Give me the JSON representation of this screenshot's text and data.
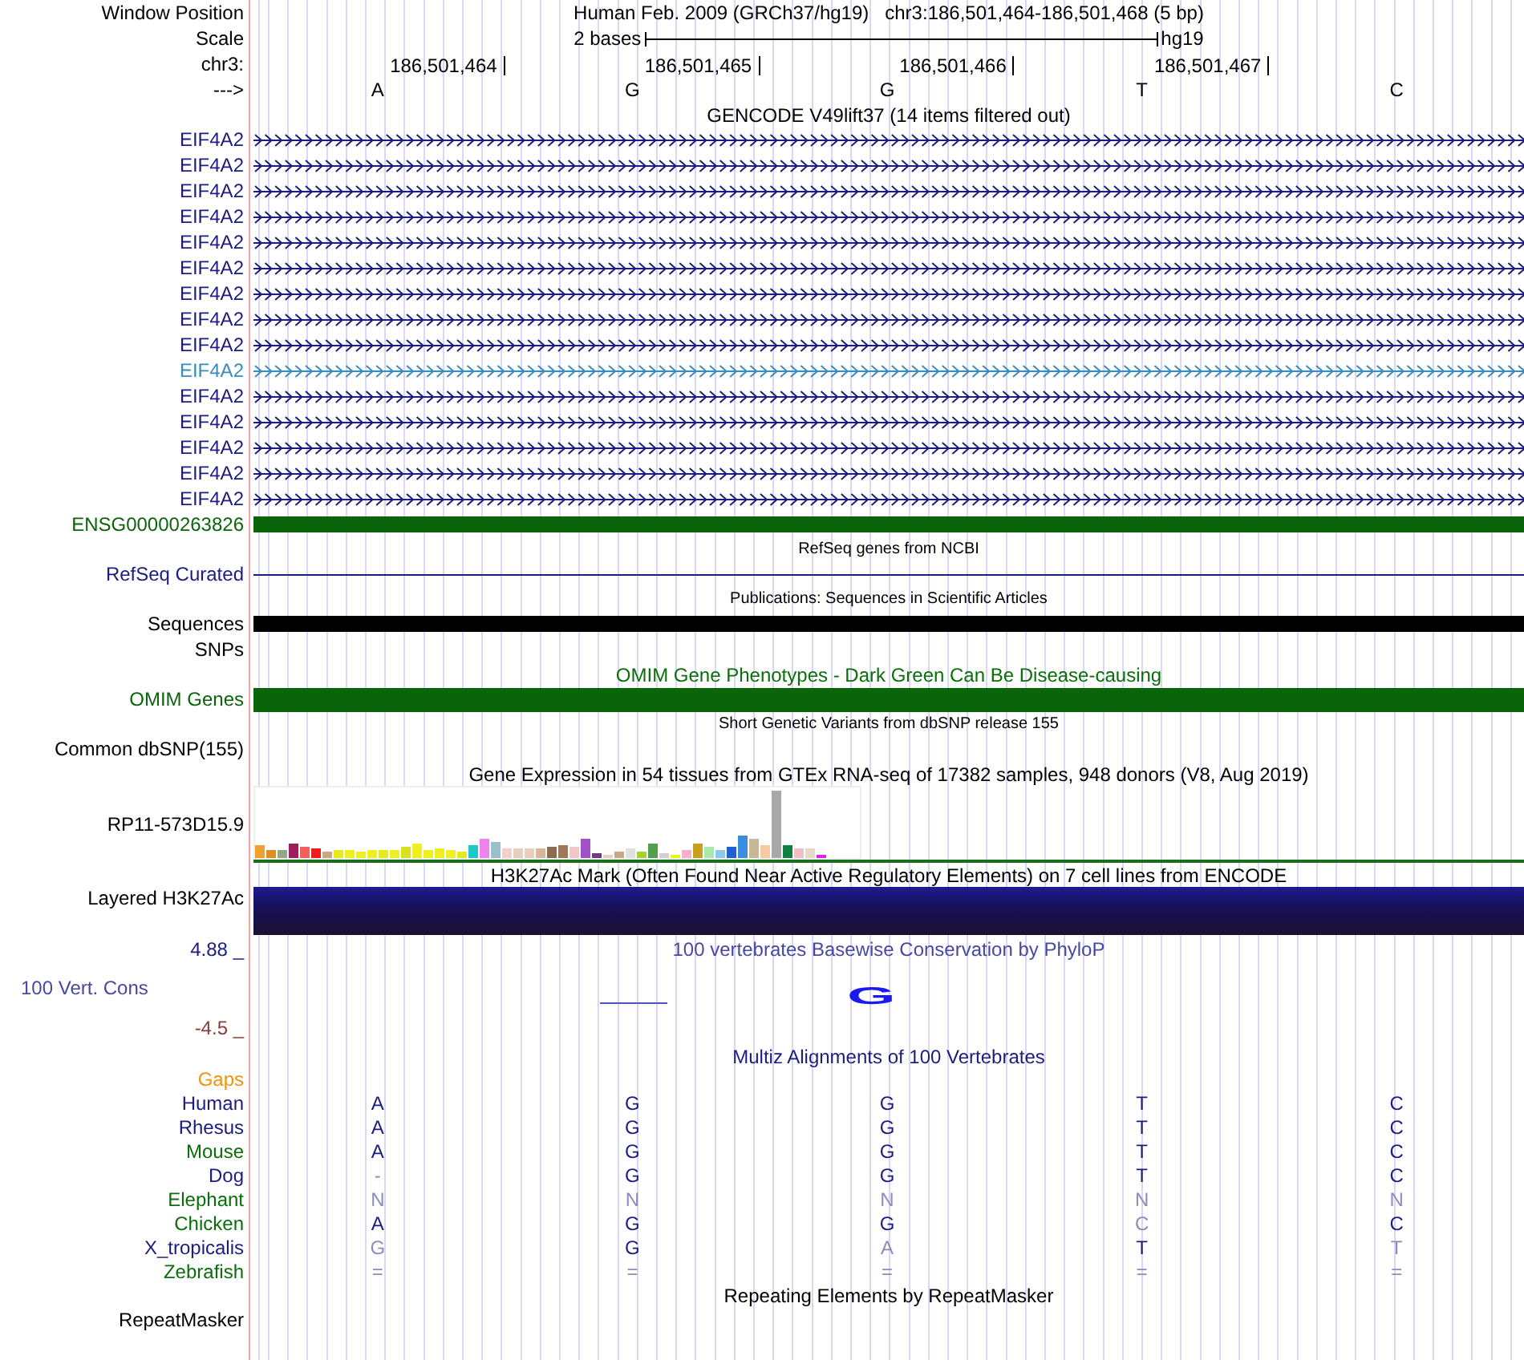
{
  "header": {
    "position": {
      "label": "Window Position",
      "text": "Human Feb. 2009 (GRCh37/hg19)   chr3:186,501,464-186,501,468 (5 bp)"
    },
    "scale": {
      "label": "Scale",
      "span": "2 bases",
      "assembly": "hg19"
    },
    "coords": {
      "label": "chr3:",
      "ticks": [
        "186,501,464",
        "186,501,465",
        "186,501,466",
        "186,501,467"
      ]
    },
    "strand": {
      "label": "--->",
      "bases": [
        "A",
        "G",
        "G",
        "T",
        "C"
      ]
    }
  },
  "tracks": [
    {
      "kind": "title",
      "text": "GENCODE V49lift37 (14 items filtered out)",
      "color": "#000000"
    },
    {
      "kind": "genes",
      "rows": [
        {
          "label": "EIF4A2",
          "color": "#1c1c80"
        },
        {
          "label": "EIF4A2",
          "color": "#1c1c80"
        },
        {
          "label": "EIF4A2",
          "color": "#1c1c80"
        },
        {
          "label": "EIF4A2",
          "color": "#1c1c80"
        },
        {
          "label": "EIF4A2",
          "color": "#1c1c80"
        },
        {
          "label": "EIF4A2",
          "color": "#1c1c80"
        },
        {
          "label": "EIF4A2",
          "color": "#1c1c80"
        },
        {
          "label": "EIF4A2",
          "color": "#1c1c80"
        },
        {
          "label": "EIF4A2",
          "color": "#1c1c80"
        },
        {
          "label": "EIF4A2",
          "color": "#3a8cc0"
        },
        {
          "label": "EIF4A2",
          "color": "#1c1c80"
        },
        {
          "label": "EIF4A2",
          "color": "#1c1c80"
        },
        {
          "label": "EIF4A2",
          "color": "#1c1c80"
        },
        {
          "label": "EIF4A2",
          "color": "#1c1c80"
        },
        {
          "label": "EIF4A2",
          "color": "#1c1c80"
        }
      ]
    },
    {
      "kind": "block",
      "label": "ENSG00000263826",
      "color": "#0a640a"
    },
    {
      "kind": "note",
      "text": "RefSeq genes from NCBI"
    },
    {
      "kind": "line",
      "label": "RefSeq Curated",
      "color": "#1c1c80"
    },
    {
      "kind": "note",
      "text": "Publications: Sequences in Scientific Articles"
    },
    {
      "kind": "block",
      "label": "Sequences",
      "color": "#000000"
    },
    {
      "kind": "empty",
      "label": "SNPs"
    },
    {
      "kind": "title",
      "text": "OMIM Gene Phenotypes - Dark Green Can Be Disease-causing",
      "color": "#0a6e0a"
    },
    {
      "kind": "block",
      "label": "OMIM Genes",
      "color": "#0a640a"
    },
    {
      "kind": "note",
      "text": "Short Genetic Variants from dbSNP release 155"
    },
    {
      "kind": "empty",
      "label": "Common dbSNP(155)"
    },
    {
      "kind": "title",
      "text": "Gene Expression in 54 tissues from GTEx RNA-seq of 17382 samples, 948 donors (V8, Aug 2019)",
      "color": "#000000"
    },
    {
      "kind": "expression",
      "label": "RP11-573D15.9"
    },
    {
      "kind": "title",
      "text": "H3K27Ac Mark (Often Found Near Active Regulatory Elements) on 7 cell lines from ENCODE",
      "color": "#000000"
    },
    {
      "kind": "density",
      "label": "Layered H3K27Ac"
    },
    {
      "kind": "conservation",
      "max": "4.88 _",
      "label": "100 Vert. Cons",
      "min": "-4.5 _",
      "title": "100 vertebrates Basewise Conservation by PhyloP",
      "logo_letter": "G"
    },
    {
      "kind": "title",
      "text": "Multiz Alignments of 100 Vertebrates",
      "color": "#1c1c80"
    },
    {
      "kind": "alignment",
      "gaps_label": "Gaps",
      "species": [
        {
          "name": "Human",
          "color": "#1c1c80",
          "bases": [
            {
              "base": "A",
              "faded": false
            },
            {
              "base": "G",
              "faded": false
            },
            {
              "base": "G",
              "faded": false
            },
            {
              "base": "T",
              "faded": false
            },
            {
              "base": "C",
              "faded": false
            }
          ]
        },
        {
          "name": "Rhesus",
          "color": "#1c1c80",
          "bases": [
            {
              "base": "A",
              "faded": false
            },
            {
              "base": "G",
              "faded": false
            },
            {
              "base": "G",
              "faded": false
            },
            {
              "base": "T",
              "faded": false
            },
            {
              "base": "C",
              "faded": false
            }
          ]
        },
        {
          "name": "Mouse",
          "color": "#0a6e0a",
          "bases": [
            {
              "base": "A",
              "faded": false
            },
            {
              "base": "G",
              "faded": false
            },
            {
              "base": "G",
              "faded": false
            },
            {
              "base": "T",
              "faded": false
            },
            {
              "base": "C",
              "faded": false
            }
          ]
        },
        {
          "name": "Dog",
          "color": "#1c1c80",
          "bases": [
            {
              "base": "-",
              "faded": true
            },
            {
              "base": "G",
              "faded": false
            },
            {
              "base": "G",
              "faded": false
            },
            {
              "base": "T",
              "faded": false
            },
            {
              "base": "C",
              "faded": false
            }
          ]
        },
        {
          "name": "Elephant",
          "color": "#0a6e0a",
          "bases": [
            {
              "base": "N",
              "faded": true
            },
            {
              "base": "N",
              "faded": true
            },
            {
              "base": "N",
              "faded": true
            },
            {
              "base": "N",
              "faded": true
            },
            {
              "base": "N",
              "faded": true
            }
          ]
        },
        {
          "name": "Chicken",
          "color": "#0a6e0a",
          "bases": [
            {
              "base": "A",
              "faded": false
            },
            {
              "base": "G",
              "faded": false
            },
            {
              "base": "G",
              "faded": false
            },
            {
              "base": "C",
              "faded": true
            },
            {
              "base": "C",
              "faded": false
            }
          ]
        },
        {
          "name": "X_tropicalis",
          "color": "#1c1c80",
          "bases": [
            {
              "base": "G",
              "faded": true
            },
            {
              "base": "G",
              "faded": false
            },
            {
              "base": "A",
              "faded": true
            },
            {
              "base": "T",
              "faded": false
            },
            {
              "base": "T",
              "faded": true
            }
          ]
        },
        {
          "name": "Zebrafish",
          "color": "#0a6e0a",
          "bases": [
            {
              "base": "=",
              "faded": true
            },
            {
              "base": "=",
              "faded": true
            },
            {
              "base": "=",
              "faded": true
            },
            {
              "base": "=",
              "faded": true
            },
            {
              "base": "=",
              "faded": true
            }
          ]
        }
      ]
    },
    {
      "kind": "title",
      "text": "Repeating Elements by RepeatMasker",
      "color": "#000000"
    },
    {
      "kind": "empty",
      "label": "RepeatMasker"
    }
  ]
}
